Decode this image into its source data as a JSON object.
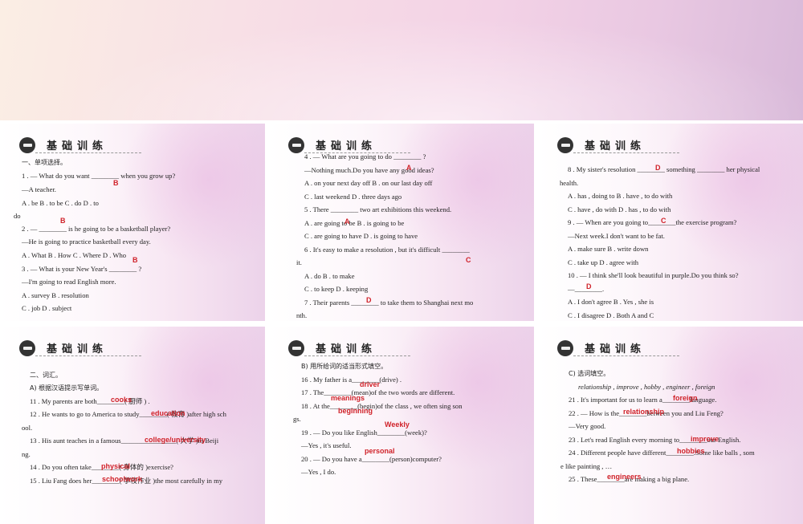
{
  "section_header": "基础训练",
  "panels": [
    {
      "lines": [
        "一、单项选择。",
        "1 .  — What do you want ________ when you grow up?",
        "—A teacher.",
        "A .  be              B .  to be            C .  do              D .  to",
        "do",
        "2 .  — ________ is he going to be a basketball player?",
        "—He is going to practice basketball every day.",
        "A .  What  B .  How  C .  Where  D .  Who",
        "3 .  — What is your New Year's ________ ?",
        "—I'm going to read English more.",
        "A .  survey  B .  resolution",
        "C .  job  D .  subject"
      ],
      "answers": [
        "B",
        "B",
        "B"
      ]
    },
    {
      "lines": [
        "4 .  — What are you going to do ________ ?",
        "—Nothing much.Do you have any good ideas?",
        "A .  on your next day off  B .  on our last day off",
        "C .  last weekend  D .  three days ago",
        "5 .  There ________ two art exhibitions this weekend.",
        "A .  are going to be  B .  is going to be",
        "C .  are going to have  D .  is going to have",
        "6 .  It's easy to make a resolution ,  but it's difficult ________",
        "it.",
        "A .  do  B .  to make",
        "C .  to keep  D .  keeping",
        "7 .  Their parents ________ to take them to Shanghai next mo",
        "nth."
      ],
      "answers": [
        "A",
        "A",
        "C",
        "D"
      ]
    },
    {
      "lines": [
        "8 .  My sister's resolution ________ something ________ her physical",
        "health.",
        "A .  has ,  doing to  B .  have ,  to do with",
        "C .  have ,  do with  D .  has ,  to do with",
        "9 .  — When are you going to________the exercise program?",
        "—Next week.I don't want to be fat.",
        "A .  make sure  B .  write down",
        "C .  take up  D .  agree with",
        "10 .  — I think she'll look beautiful in purple.Do you think so?",
        "—________.",
        "A .  I don't agree  B .  Yes ,  she is",
        "C .  I disagree  D .  Both A and C"
      ],
      "answers": [
        "D",
        "C",
        "D"
      ]
    },
    {
      "lines": [
        "二、词汇。",
        "A) 根据汉语提示写单词。",
        "11 .  My parents are both________( 厨师 ) .",
        "12 .  He wants to go to America to study________( 教育 )after high sch",
        "ool.",
        "13 .  His aunt teaches in a famous________________( 大学 )in Beiji",
        "ng.",
        "14 .  Do you often take________( 身体的 )exercise?",
        "15 .  Liu Fang does her________( 学校作业 )the most carefully in my"
      ],
      "answers": [
        "cooks",
        "education",
        "college/university",
        "physical",
        "schoolwork"
      ]
    },
    {
      "lines": [
        "B) 用所给词的适当形式填空。",
        "16 .  My father is a________(drive) .",
        "17 .  The________(mean)of the two words are different.",
        "18 .  At the________(begin)of the class ,  we often sing son",
        "gs.",
        "19 .  — Do you like English________(week)?",
        "—Yes ,  it's useful.",
        "20 .  — Do you have a________(person)computer?",
        "—Yes ,  I do."
      ],
      "answers": [
        "driver",
        "meanings",
        "beginning",
        "Weekly",
        "personal"
      ]
    },
    {
      "lines": [
        "C) 选词填空。",
        "relationship ,  improve ,  hobby ,  engineer ,  foreign",
        "21 .  It's important for us to learn a________language.",
        "22 .  — How is the________between you and Liu Feng?",
        "—Very good.",
        "23 .  Let's read English every morning to________our English.",
        "24 .  Different people have different________.Some like balls ,  som",
        "e like painting ,  …",
        "25 .  These________are making a big plane."
      ],
      "answers": [
        "foreign",
        "relationship",
        "improve",
        "hobbies",
        "engineers"
      ]
    }
  ]
}
